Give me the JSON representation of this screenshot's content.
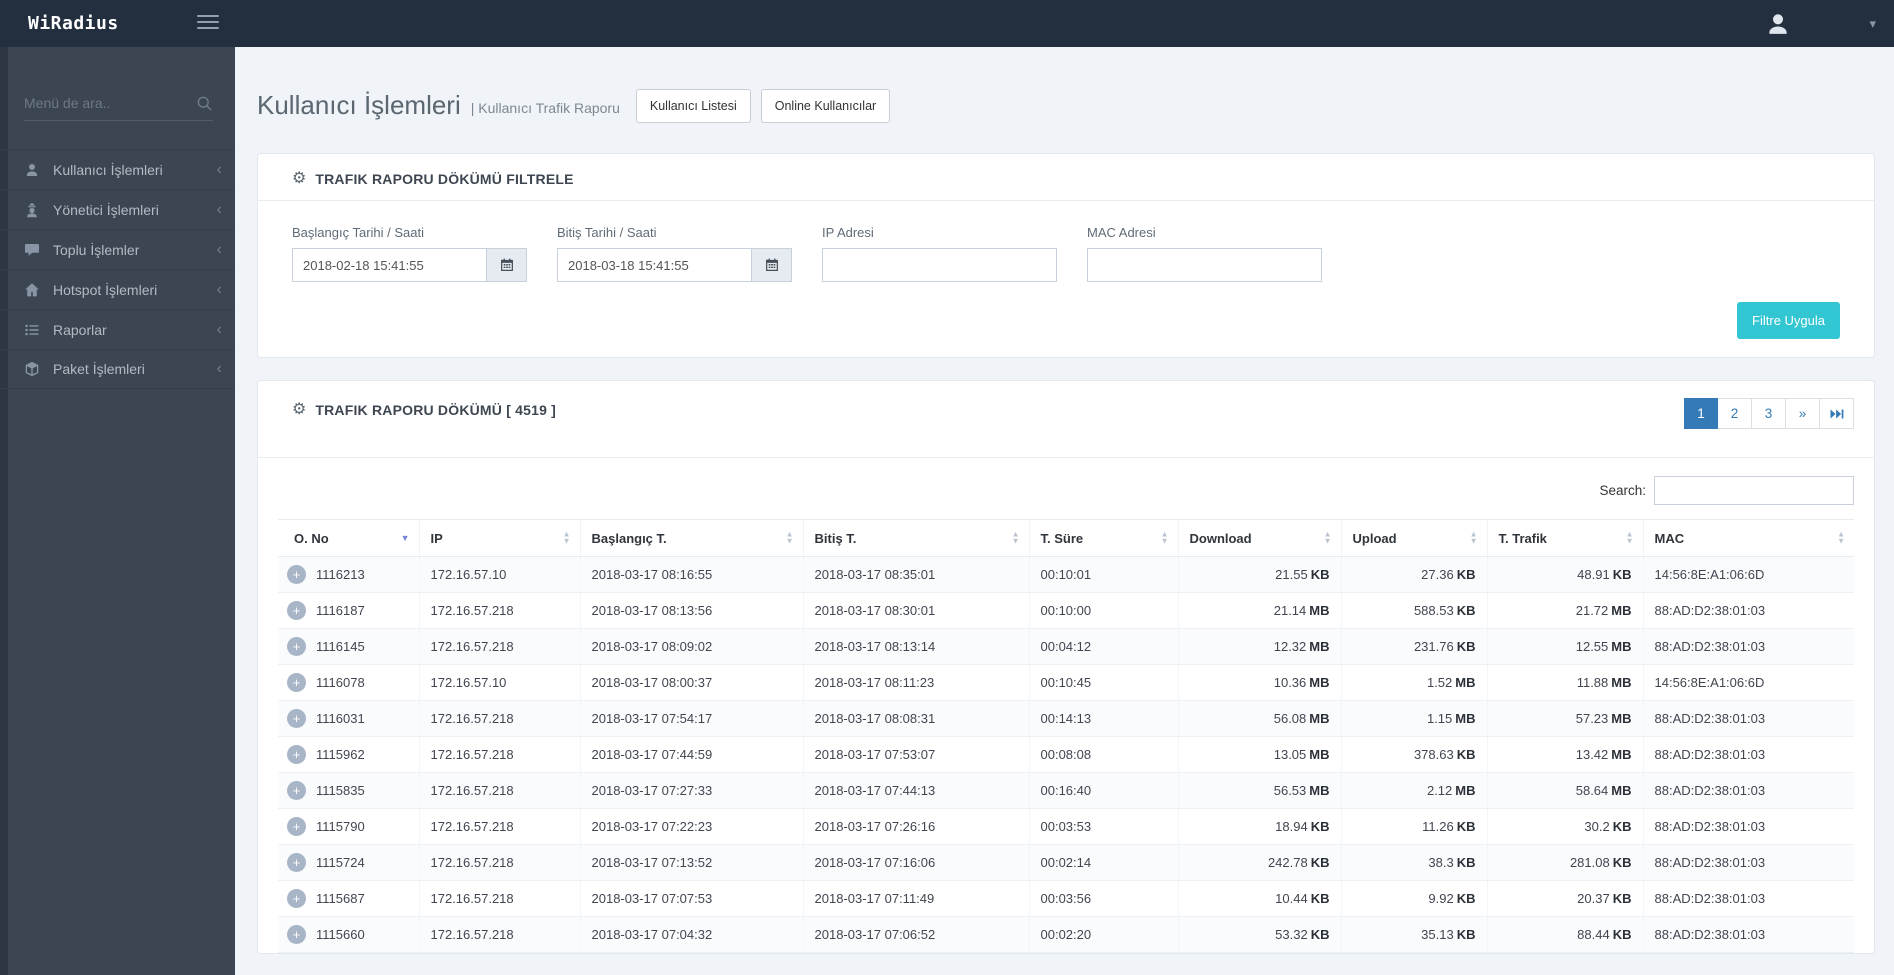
{
  "navbar": {
    "brand": "WiRadius"
  },
  "sidebar": {
    "search_placeholder": "Menü de ara..",
    "items": [
      {
        "label": "Kullanıcı İşlemleri",
        "icon": "user-icon"
      },
      {
        "label": "Yönetici İşlemleri",
        "icon": "user-secret-icon"
      },
      {
        "label": "Toplu İşlemler",
        "icon": "comment-icon"
      },
      {
        "label": "Hotspot İşlemleri",
        "icon": "home-icon"
      },
      {
        "label": "Raporlar",
        "icon": "list-icon"
      },
      {
        "label": "Paket İşlemleri",
        "icon": "cube-icon"
      }
    ]
  },
  "page": {
    "title": "Kullanıcı İşlemleri",
    "subtitle": "| Kullanıcı Trafik Raporu",
    "buttons": [
      "Kullanıcı Listesi",
      "Online Kullanıcılar"
    ]
  },
  "filter": {
    "title": "TRAFIK RAPORU DÖKÜMÜ FILTRELE",
    "start": {
      "label": "Başlangıç Tarihi / Saati",
      "value": "2018-02-18 15:41:55"
    },
    "end": {
      "label": "Bitiş Tarihi / Saati",
      "value": "2018-03-18 15:41:55"
    },
    "ip": {
      "label": "IP Adresi",
      "value": ""
    },
    "mac": {
      "label": "MAC Adresi",
      "value": ""
    },
    "apply_label": "Filtre Uygula"
  },
  "report": {
    "title": "TRAFIK RAPORU DÖKÜMÜ [ 4519 ]",
    "count": "4519",
    "search_label": "Search:",
    "pagination": [
      {
        "label": "1",
        "active": true
      },
      {
        "label": "2"
      },
      {
        "label": "3"
      },
      {
        "label": "»"
      },
      {
        "icon": "skip-end-icon"
      }
    ],
    "table": {
      "columns": [
        {
          "label": "O. No",
          "sort": "desc"
        },
        {
          "label": "IP",
          "sort": "both"
        },
        {
          "label": "Başlangıç T.",
          "sort": "both"
        },
        {
          "label": "Bitiş T.",
          "sort": "both"
        },
        {
          "label": "T. Süre",
          "sort": "both"
        },
        {
          "label": "Download",
          "sort": "both"
        },
        {
          "label": "Upload",
          "sort": "both"
        },
        {
          "label": "T. Trafik",
          "sort": "both"
        },
        {
          "label": "MAC",
          "sort": "both"
        }
      ],
      "rows": [
        {
          "ono": "1116213",
          "ip": "172.16.57.10",
          "start": "2018-03-17 08:16:55",
          "end": "2018-03-17 08:35:01",
          "duration": "00:10:01",
          "download": "21.55",
          "download_unit": "KB",
          "upload": "27.36",
          "upload_unit": "KB",
          "traffic": "48.91",
          "traffic_unit": "KB",
          "mac": "14:56:8E:A1:06:6D"
        },
        {
          "ono": "1116187",
          "ip": "172.16.57.218",
          "start": "2018-03-17 08:13:56",
          "end": "2018-03-17 08:30:01",
          "duration": "00:10:00",
          "download": "21.14",
          "download_unit": "MB",
          "upload": "588.53",
          "upload_unit": "KB",
          "traffic": "21.72",
          "traffic_unit": "MB",
          "mac": "88:AD:D2:38:01:03"
        },
        {
          "ono": "1116145",
          "ip": "172.16.57.218",
          "start": "2018-03-17 08:09:02",
          "end": "2018-03-17 08:13:14",
          "duration": "00:04:12",
          "download": "12.32",
          "download_unit": "MB",
          "upload": "231.76",
          "upload_unit": "KB",
          "traffic": "12.55",
          "traffic_unit": "MB",
          "mac": "88:AD:D2:38:01:03"
        },
        {
          "ono": "1116078",
          "ip": "172.16.57.10",
          "start": "2018-03-17 08:00:37",
          "end": "2018-03-17 08:11:23",
          "duration": "00:10:45",
          "download": "10.36",
          "download_unit": "MB",
          "upload": "1.52",
          "upload_unit": "MB",
          "traffic": "11.88",
          "traffic_unit": "MB",
          "mac": "14:56:8E:A1:06:6D"
        },
        {
          "ono": "1116031",
          "ip": "172.16.57.218",
          "start": "2018-03-17 07:54:17",
          "end": "2018-03-17 08:08:31",
          "duration": "00:14:13",
          "download": "56.08",
          "download_unit": "MB",
          "upload": "1.15",
          "upload_unit": "MB",
          "traffic": "57.23",
          "traffic_unit": "MB",
          "mac": "88:AD:D2:38:01:03"
        },
        {
          "ono": "1115962",
          "ip": "172.16.57.218",
          "start": "2018-03-17 07:44:59",
          "end": "2018-03-17 07:53:07",
          "duration": "00:08:08",
          "download": "13.05",
          "download_unit": "MB",
          "upload": "378.63",
          "upload_unit": "KB",
          "traffic": "13.42",
          "traffic_unit": "MB",
          "mac": "88:AD:D2:38:01:03"
        },
        {
          "ono": "1115835",
          "ip": "172.16.57.218",
          "start": "2018-03-17 07:27:33",
          "end": "2018-03-17 07:44:13",
          "duration": "00:16:40",
          "download": "56.53",
          "download_unit": "MB",
          "upload": "2.12",
          "upload_unit": "MB",
          "traffic": "58.64",
          "traffic_unit": "MB",
          "mac": "88:AD:D2:38:01:03"
        },
        {
          "ono": "1115790",
          "ip": "172.16.57.218",
          "start": "2018-03-17 07:22:23",
          "end": "2018-03-17 07:26:16",
          "duration": "00:03:53",
          "download": "18.94",
          "download_unit": "KB",
          "upload": "11.26",
          "upload_unit": "KB",
          "traffic": "30.2",
          "traffic_unit": "KB",
          "mac": "88:AD:D2:38:01:03"
        },
        {
          "ono": "1115724",
          "ip": "172.16.57.218",
          "start": "2018-03-17 07:13:52",
          "end": "2018-03-17 07:16:06",
          "duration": "00:02:14",
          "download": "242.78",
          "download_unit": "KB",
          "upload": "38.3",
          "upload_unit": "KB",
          "traffic": "281.08",
          "traffic_unit": "KB",
          "mac": "88:AD:D2:38:01:03"
        },
        {
          "ono": "1115687",
          "ip": "172.16.57.218",
          "start": "2018-03-17 07:07:53",
          "end": "2018-03-17 07:11:49",
          "duration": "00:03:56",
          "download": "10.44",
          "download_unit": "KB",
          "upload": "9.92",
          "upload_unit": "KB",
          "traffic": "20.37",
          "traffic_unit": "KB",
          "mac": "88:AD:D2:38:01:03"
        },
        {
          "ono": "1115660",
          "ip": "172.16.57.218",
          "start": "2018-03-17 07:04:32",
          "end": "2018-03-17 07:06:52",
          "duration": "00:02:20",
          "download": "53.32",
          "download_unit": "KB",
          "upload": "35.13",
          "upload_unit": "KB",
          "traffic": "88.44",
          "traffic_unit": "KB",
          "mac": "88:AD:D2:38:01:03"
        }
      ]
    }
  },
  "colors": {
    "navbar": "#232e3e",
    "sidebar": "#3c4653",
    "accent": "#32c5d2",
    "pagination_active": "#337ab7",
    "page_bg": "#f0f3f7"
  }
}
